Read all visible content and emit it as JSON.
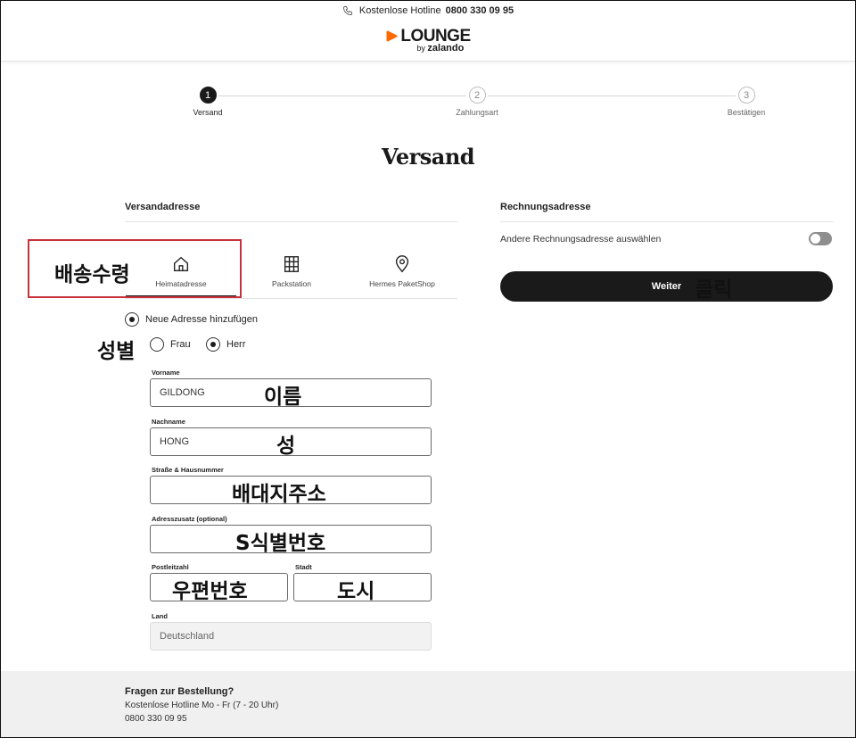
{
  "topbar": {
    "hotline_label": "Kostenlose Hotline",
    "hotline_number": "0800 330 09 95"
  },
  "logo": {
    "brand": "LOUNGE",
    "by": "by",
    "partner": "zalando",
    "accent_color": "#ff6900"
  },
  "steps": [
    {
      "number": "1",
      "label": "Versand"
    },
    {
      "number": "2",
      "label": "Zahlungsart"
    },
    {
      "number": "3",
      "label": "Bestätigen"
    }
  ],
  "page_title": "Versand",
  "shipping": {
    "section_title": "Versandadresse",
    "tabs": [
      {
        "label": "Heimatadresse",
        "icon": "home-icon"
      },
      {
        "label": "Packstation",
        "icon": "locker-icon"
      },
      {
        "label": "Hermes PaketShop",
        "icon": "location-pin-icon"
      }
    ],
    "new_address_label": "Neue Adresse hinzufügen",
    "salutation": {
      "options": [
        "Frau",
        "Herr"
      ],
      "selected": "Herr"
    },
    "fields": {
      "first_name": {
        "label": "Vorname",
        "value": "GILDONG"
      },
      "last_name": {
        "label": "Nachname",
        "value": "HONG"
      },
      "street": {
        "label": "Straße & Hausnummer",
        "value": ""
      },
      "address_extra": {
        "label": "Adresszusatz (optional)",
        "value": ""
      },
      "postal_code": {
        "label": "Postleitzahl",
        "value": ""
      },
      "city": {
        "label": "Stadt",
        "value": ""
      },
      "country": {
        "label": "Land",
        "value": "Deutschland"
      }
    }
  },
  "billing": {
    "section_title": "Rechnungsadresse",
    "toggle_label": "Andere Rechnungsadresse auswählen",
    "toggle_on": false
  },
  "continue_button": {
    "label": "Weiter"
  },
  "annotations": {
    "delivery": "배송수령",
    "gender": "성별",
    "first_name": "이름",
    "last_name": "성",
    "street": "배대지주소",
    "id_number": "S식별번호",
    "postal_code": "우편번호",
    "city": "도시",
    "click": "클릭"
  },
  "footer": {
    "title": "Fragen zur Bestellung?",
    "hours": "Kostenlose Hotline Mo - Fr (7 - 20 Uhr)",
    "number": "0800 330 09 95"
  }
}
